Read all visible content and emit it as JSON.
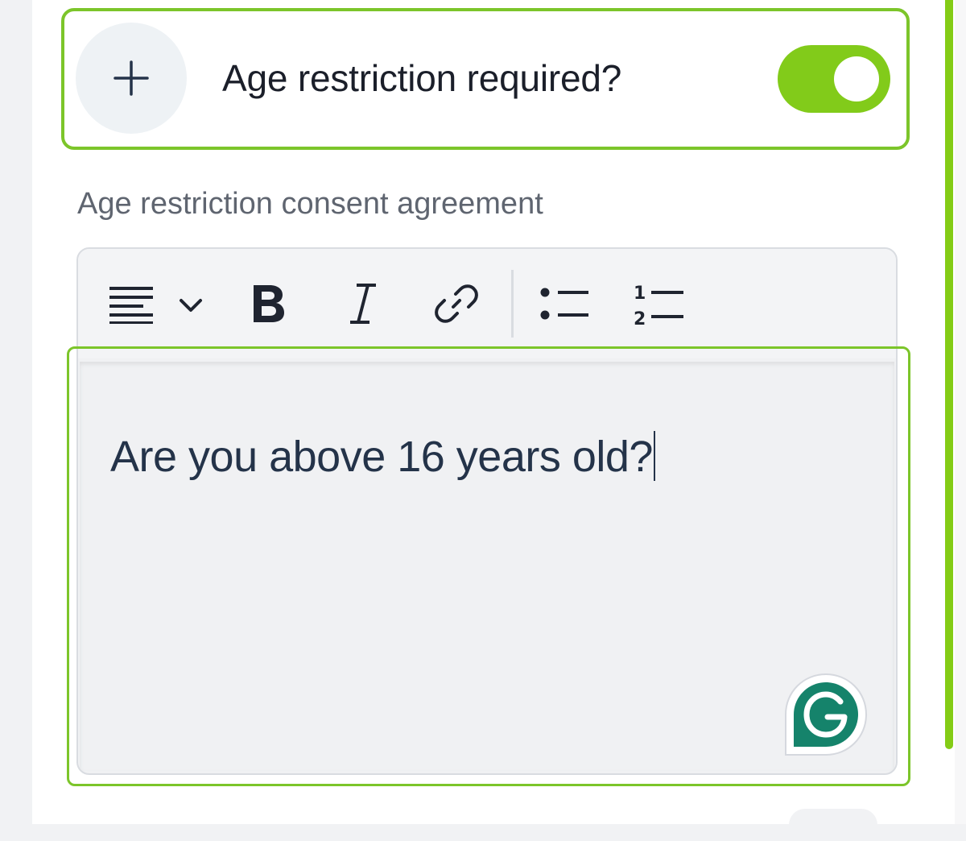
{
  "age_restriction": {
    "toggle_label": "Age restriction required?",
    "toggle_on": true,
    "add_icon": "plus-icon",
    "accent_color": "#82cb1a"
  },
  "consent": {
    "label": "Age restriction consent agreement",
    "editor_text": "Are you above 16 years old?",
    "toolbar": {
      "align_icon": "align-left-icon",
      "align_dropdown_icon": "chevron-down-icon",
      "bold_icon": "bold-icon",
      "italic_icon": "italic-icon",
      "link_icon": "link-icon",
      "bullet_list_icon": "bulleted-list-icon",
      "numbered_list_icon": "numbered-list-icon",
      "numbered_list_digits": [
        "1",
        "2"
      ]
    },
    "grammarly_icon": "grammarly-icon"
  }
}
